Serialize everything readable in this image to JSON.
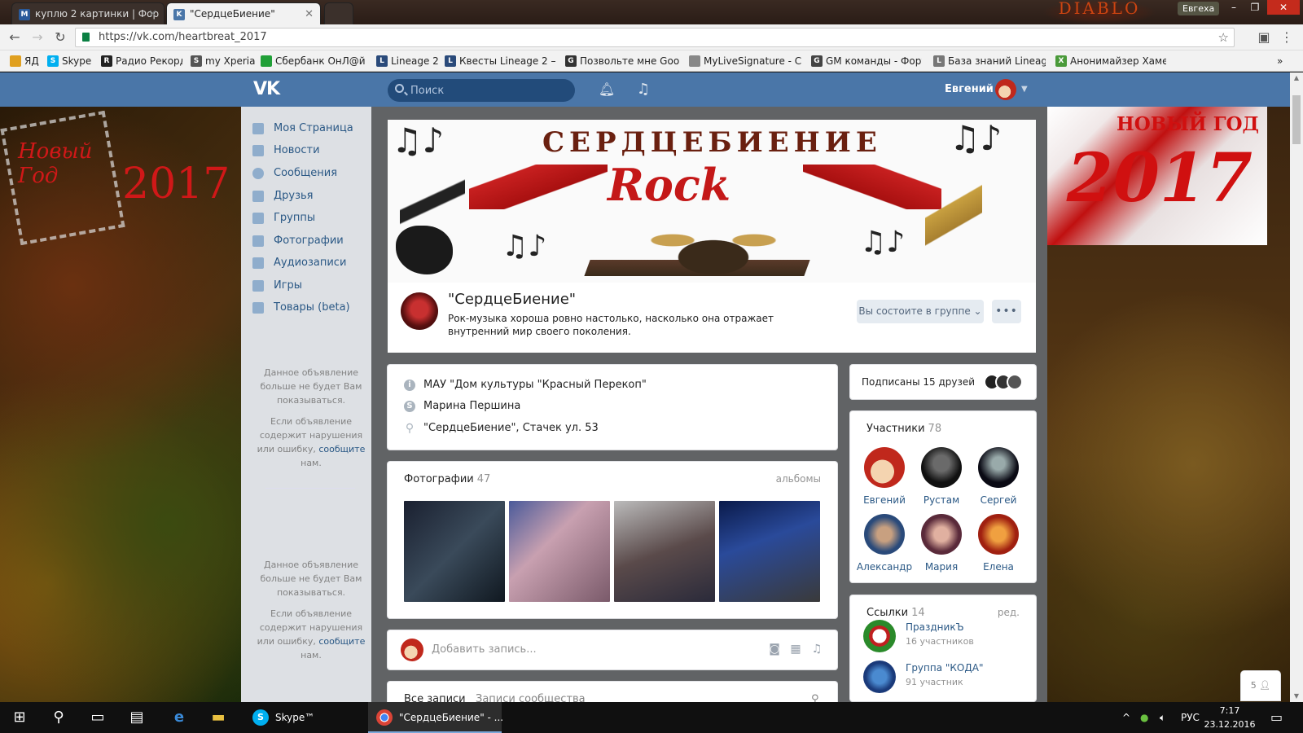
{
  "browser": {
    "tabs": [
      {
        "label": "куплю 2 картинки | Фор",
        "favicon": "forum-icon"
      },
      {
        "label": "\"СердцеБиение\"",
        "favicon": "vk-icon"
      }
    ],
    "window_user": "Евгеха",
    "window_logo": "DIABLO",
    "url": "https://vk.com/heartbreat_2017",
    "bookmarks": [
      "ЯД",
      "Skype",
      "Радио Рекорд",
      "my Xperia",
      "Сбербанк ОнЛ@йн",
      "Lineage 2",
      "Квесты Lineage 2 — F",
      "Позвольте мне Goog",
      "MyLiveSignature - Co",
      "GM команды - Форум",
      "База знаний Lineage",
      "Анонимайзер Хамел"
    ],
    "bookmarks_more": "»"
  },
  "header": {
    "logo": "VK",
    "search_placeholder": "Поиск",
    "user_name": "Евгений"
  },
  "sidebar": {
    "items": [
      {
        "label": "Моя Страница"
      },
      {
        "label": "Новости"
      },
      {
        "label": "Сообщения"
      },
      {
        "label": "Друзья"
      },
      {
        "label": "Группы"
      },
      {
        "label": "Фотографии"
      },
      {
        "label": "Аудиозаписи"
      },
      {
        "label": "Игры"
      },
      {
        "label": "Товары (beta)"
      }
    ],
    "ad_hidden_1": "Данное объявление больше не будет Вам показываться.",
    "ad_report_1": "Если объявление содержит нарушения или ошибку,",
    "ad_report_link_1": "сообщите",
    "ad_report_end_1": "нам.",
    "ad_hidden_2": "Данное объявление больше не будет Вам показываться.",
    "ad_report_2": "Если объявление содержит нарушения или ошибку,",
    "ad_report_link_2": "сообщите",
    "ad_report_end_2": "нам."
  },
  "cover": {
    "title": "СЕРДЦЕБИЕНИЕ",
    "logo_text": "Rock"
  },
  "group": {
    "name": "\"СердцеБиение\"",
    "description": "Рок-музыка хороша ровно настолько, насколько она отражает внутренний мир своего поколения.",
    "member_button": "Вы состоите в группе ⌄",
    "more_button": "•••"
  },
  "info": {
    "rows": [
      {
        "text": "МАУ \"Дом культуры \"Красный Перекоп\"",
        "icon": "i"
      },
      {
        "text": "Марина Першина",
        "icon": "S"
      },
      {
        "text": "\"СердцеБиение\", Стачек ул. 53",
        "icon": "pin"
      }
    ]
  },
  "photos": {
    "title": "Фотографии",
    "count": "47",
    "albums_link": "альбомы"
  },
  "post": {
    "placeholder": "Добавить запись..."
  },
  "wall": {
    "tab_all": "Все записи",
    "tab_community": "Записи сообщества"
  },
  "friends": {
    "label": "Подписаны 15 друзей"
  },
  "members": {
    "title": "Участники",
    "count": "78",
    "list": [
      {
        "name": "Евгений"
      },
      {
        "name": "Рустам"
      },
      {
        "name": "Сергей"
      },
      {
        "name": "Александр"
      },
      {
        "name": "Мария"
      },
      {
        "name": "Елена"
      }
    ]
  },
  "links": {
    "title": "Ссылки",
    "count": "14",
    "edit": "ред.",
    "items": [
      {
        "name": "ПраздникЪ",
        "sub": "16 участников"
      },
      {
        "name": "Группа \"КОДА\"",
        "sub": "91 участник"
      }
    ]
  },
  "chat": {
    "count": "5"
  },
  "background": {
    "left_year": "2017",
    "left_text": "Новый Год",
    "right_text": "НОВЫЙ ГОД",
    "right_year": "2017"
  },
  "taskbar": {
    "skype_label": "Skype™",
    "chrome_label": "\"СердцеБиение\" - ...",
    "lang": "РУС",
    "time": "7:17",
    "date": "23.12.2016"
  },
  "colors": {
    "vk_header": "#4a76a8",
    "link": "#2a5885",
    "muted": "#939393"
  }
}
